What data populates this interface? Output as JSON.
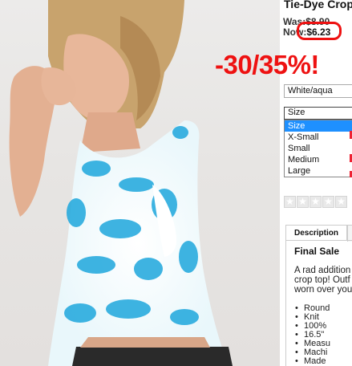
{
  "product": {
    "title": "Tie-Dye Crop",
    "was_label": "Was:",
    "was_price": "$8.90",
    "now_label": "Now:",
    "now_price": "$6.23"
  },
  "overlay": {
    "discount_text": "-30/35%!"
  },
  "color_select": {
    "selected": "White/aqua"
  },
  "size_select": {
    "selected": "Size",
    "options": [
      "Size",
      "X-Small",
      "Small",
      "Medium",
      "Large"
    ],
    "highlighted": "Size"
  },
  "rating": {
    "stars": 5,
    "filled": 0
  },
  "tabs": {
    "description": "Description"
  },
  "description": {
    "heading": "Final Sale",
    "text": "A rad addition\ncrop top! Outf\nworn over you"
  },
  "features": [
    "Round",
    "Knit",
    "100%",
    "16.5\" ",
    "Measu",
    "Machi",
    "Made"
  ],
  "colors": {
    "accent_red": "#ee1111",
    "select_highlight": "#1e90ff",
    "dye_blue": "#1ea7dd"
  }
}
